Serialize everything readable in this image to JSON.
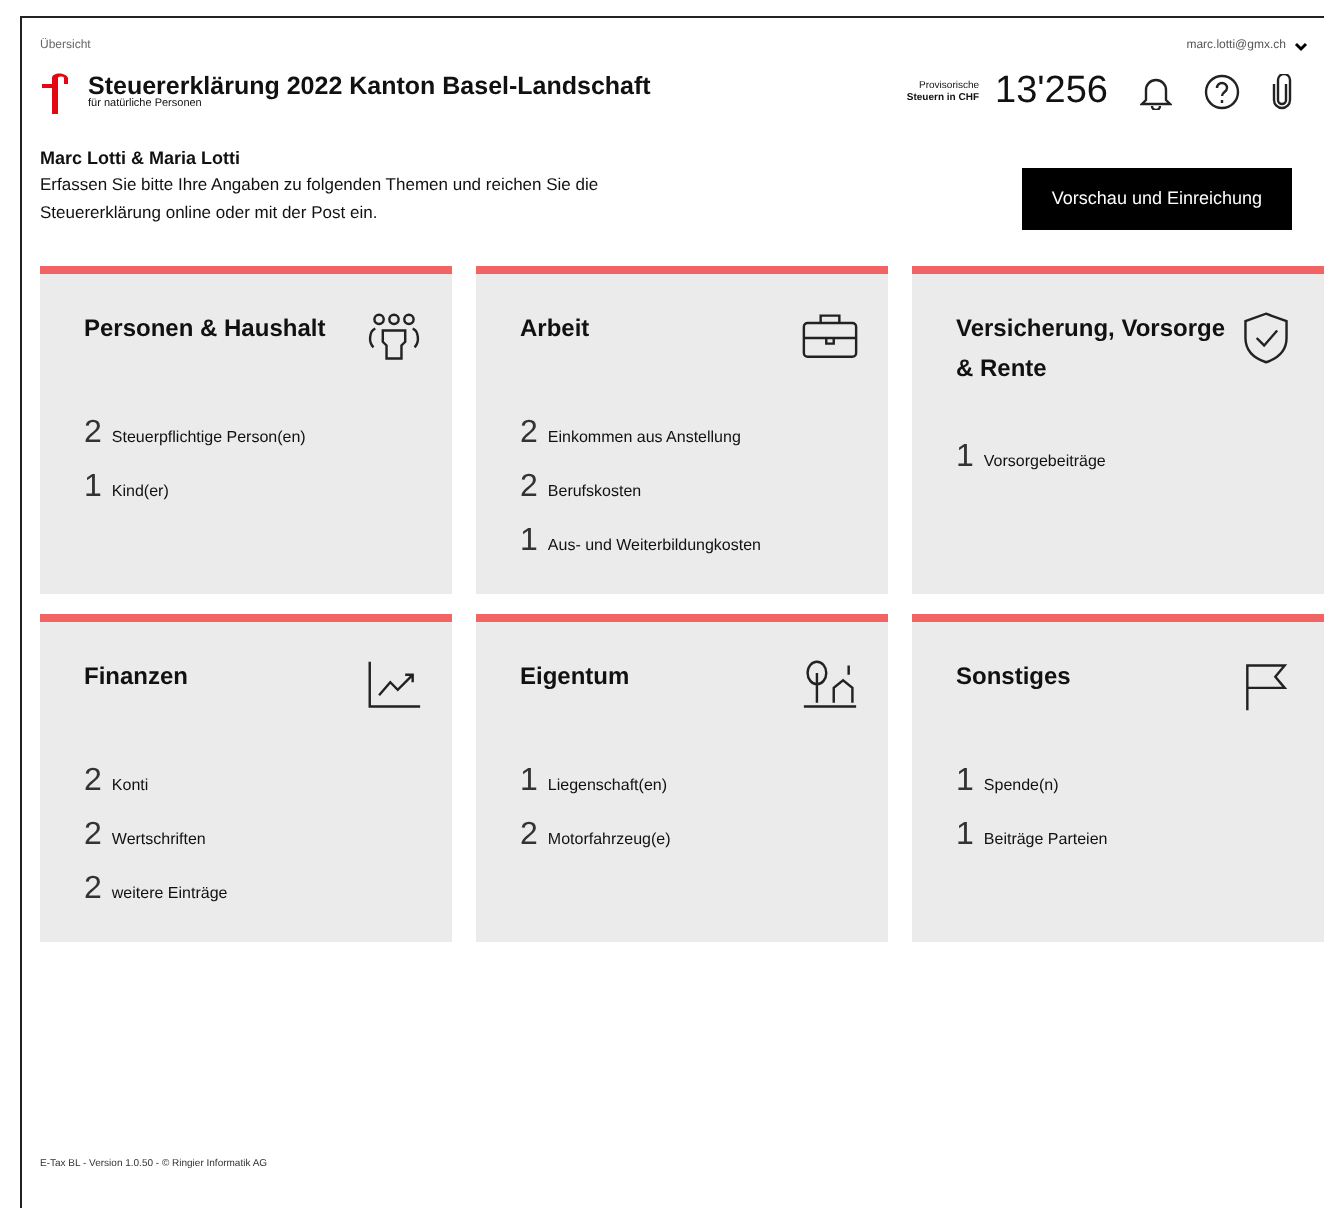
{
  "breadcrumb": "Übersicht",
  "user_menu": "marc.lotti@gmx.ch",
  "header": {
    "title": "Steuererklärung 2022 Kanton Basel-Landschaft",
    "subtitle": "für natürliche Personen"
  },
  "tax_estimate": {
    "label_line1": "Provisorische",
    "label_line2": "Steuern in CHF",
    "amount": "13'256"
  },
  "intro": {
    "names": "Marc Lotti & Maria Lotti",
    "text": "Erfassen Sie bitte Ihre Angaben zu folgenden Themen und reichen Sie die Steuererklärung online oder mit der Post ein."
  },
  "submit_button": "Vorschau und Einreichung",
  "topics": [
    {
      "title": "Personen & Haushalt",
      "kind": "people",
      "items": [
        {
          "count": "2",
          "label": "Steuerpflichtige Person(en)"
        },
        {
          "count": "1",
          "label": "Kind(er)"
        }
      ]
    },
    {
      "title": "Arbeit",
      "kind": "work",
      "items": [
        {
          "count": "2",
          "label": "Einkommen aus Anstellung"
        },
        {
          "count": "2",
          "label": "Berufskosten"
        },
        {
          "count": "1",
          "label": "Aus- und Weiterbildungkosten"
        }
      ]
    },
    {
      "title": "Versicherung, Vorsorge & Rente",
      "kind": "insurance",
      "items": [
        {
          "count": "1",
          "label": "Vorsorgebeiträge"
        }
      ]
    },
    {
      "title": "Finanzen",
      "kind": "finance",
      "items": [
        {
          "count": "2",
          "label": "Konti"
        },
        {
          "count": "2",
          "label": "Wertschriften"
        },
        {
          "count": "2",
          "label": "weitere Einträge"
        }
      ]
    },
    {
      "title": "Eigentum",
      "kind": "property",
      "items": [
        {
          "count": "1",
          "label": "Liegenschaft(en)"
        },
        {
          "count": "2",
          "label": "Motorfahrzeug(e)"
        }
      ]
    },
    {
      "title": "Sonstiges",
      "kind": "other",
      "items": [
        {
          "count": "1",
          "label": "Spende(n)"
        },
        {
          "count": "1",
          "label": "Beiträge Parteien"
        }
      ]
    }
  ],
  "footer": "E-Tax BL - Version 1.0.50 - © Ringier Informatik AG"
}
